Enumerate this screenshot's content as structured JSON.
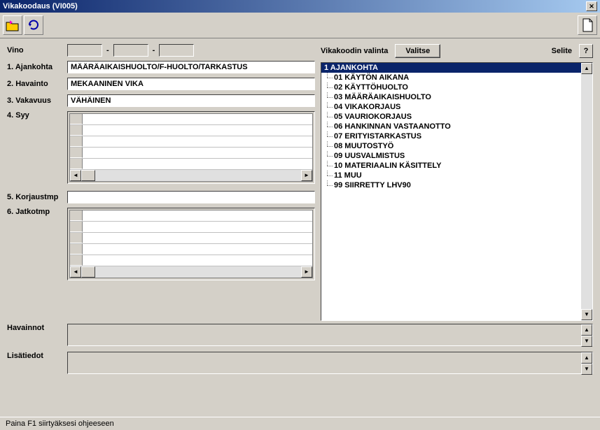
{
  "window": {
    "title": "Vikakoodaus (VI005)"
  },
  "labels": {
    "vino": "Vino",
    "ajankohta": "1. Ajankohta",
    "havainto": "2. Havainto",
    "vakavuus": "3. Vakavuus",
    "syy": "4. Syy",
    "korjaustmp": "5. Korjaustmp",
    "jatkotmp": "6. Jatkotmp",
    "havainnot": "Havainnot",
    "lisatiedot": "Lisätiedot",
    "vikakoodin_valinta": "Vikakoodin valinta",
    "valitse": "Valitse",
    "selite": "Selite",
    "help": "?"
  },
  "fields": {
    "ajankohta": "MÄÄRÄAIKAISHUOLTO/F-HUOLTO/TARKASTUS",
    "havainto": "MEKAANINEN VIKA",
    "vakavuus": "VÄHÄINEN",
    "korjaustmp": ""
  },
  "tree": {
    "root": "1 AJANKOHTA",
    "items": [
      "01 KÄYTÖN AIKANA",
      "02 KÄYTTÖHUOLTO",
      "03 MÄÄRÄAIKAISHUOLTO",
      "04 VIKAKORJAUS",
      "05 VAURIOKORJAUS",
      "06 HANKINNAN VASTAANOTTO",
      "07 ERITYISTARKASTUS",
      "08 MUUTOSTYÖ",
      "09 UUSVALMISTUS",
      "10 MATERIAALIN KÄSITTELY",
      "11 MUU",
      "99 SIIRRETTY LHV90"
    ]
  },
  "statusbar": "Paina F1 siirtyäksesi ohjeeseen"
}
